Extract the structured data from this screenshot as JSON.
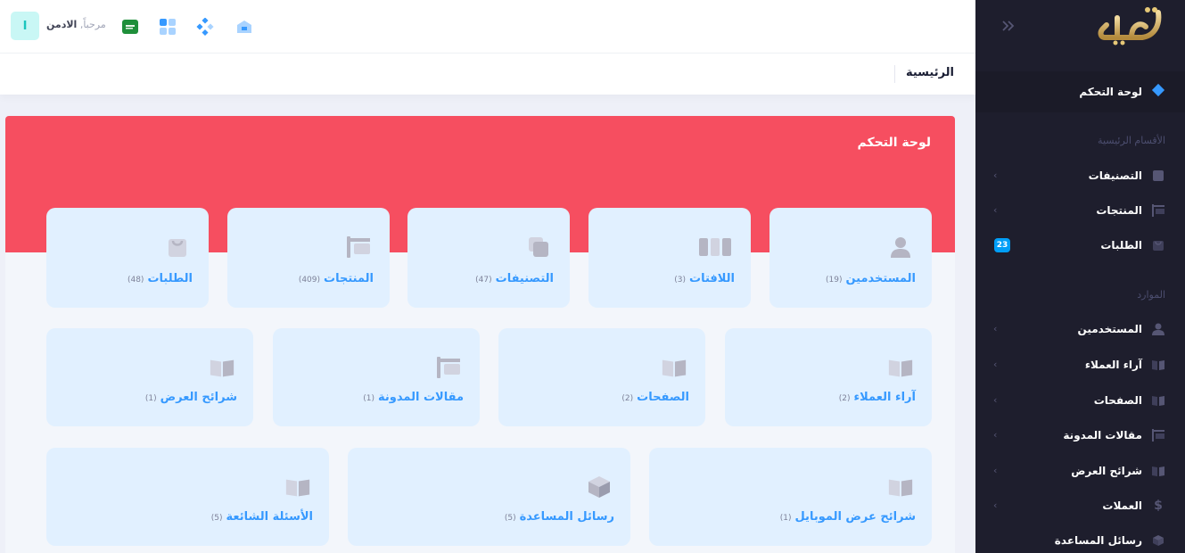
{
  "header": {
    "avatar_letter": "I",
    "greeting": "مرحباً,",
    "username": "الادمن"
  },
  "breadcrumb": "الرئيسية",
  "dashboard": {
    "title": "لوحة التحكم"
  },
  "cards_row1": [
    {
      "title": "المستخدمين",
      "count": "(19)",
      "icon": "user-icon"
    },
    {
      "title": "اللافتات",
      "count": "(3)",
      "icon": "columns-icon"
    },
    {
      "title": "التصنيفات",
      "count": "(47)",
      "icon": "layers-icon"
    },
    {
      "title": "المنتجات",
      "count": "(409)",
      "icon": "signpost-icon"
    },
    {
      "title": "الطلبات",
      "count": "(48)",
      "icon": "bag-icon"
    }
  ],
  "cards_row2": [
    {
      "title": "آراء العملاء",
      "count": "(2)",
      "icon": "book-icon"
    },
    {
      "title": "الصفحات",
      "count": "(2)",
      "icon": "book-icon"
    },
    {
      "title": "مقالات المدونة",
      "count": "(1)",
      "icon": "signpost-icon"
    },
    {
      "title": "شرائح العرض",
      "count": "(1)",
      "icon": "book-icon"
    }
  ],
  "cards_row3": [
    {
      "title": "شرائح عرض الموبايل",
      "count": "(1)",
      "icon": "book-icon"
    },
    {
      "title": "رسائل المساعدة",
      "count": "(5)",
      "icon": "box-icon"
    },
    {
      "title": "الأسئلة الشائعة",
      "count": "(5)",
      "icon": "book-icon"
    }
  ],
  "sidebar": {
    "logo_text": "تجرة",
    "active_item": "لوحة التحكم",
    "section_main": "الأقسام الرئيسية",
    "main_items": [
      {
        "label": "التصنيفات"
      },
      {
        "label": "المنتجات"
      },
      {
        "label": "الطلبات",
        "badge": "23"
      }
    ],
    "section_resources": "الموارد",
    "resource_items": [
      {
        "label": "المستخدمين"
      },
      {
        "label": "آراء العملاء"
      },
      {
        "label": "الصفحات"
      },
      {
        "label": "مقالات المدونة"
      },
      {
        "label": "شرائح العرض"
      },
      {
        "label": "العملات"
      },
      {
        "label": "رسائل المساعدة"
      }
    ]
  },
  "colors": {
    "hero": "#f64e60",
    "card_bg": "#e1f0ff",
    "card_title": "#3699ff",
    "sidebar_bg": "#1e1e2d",
    "badge": "#009ef7"
  }
}
